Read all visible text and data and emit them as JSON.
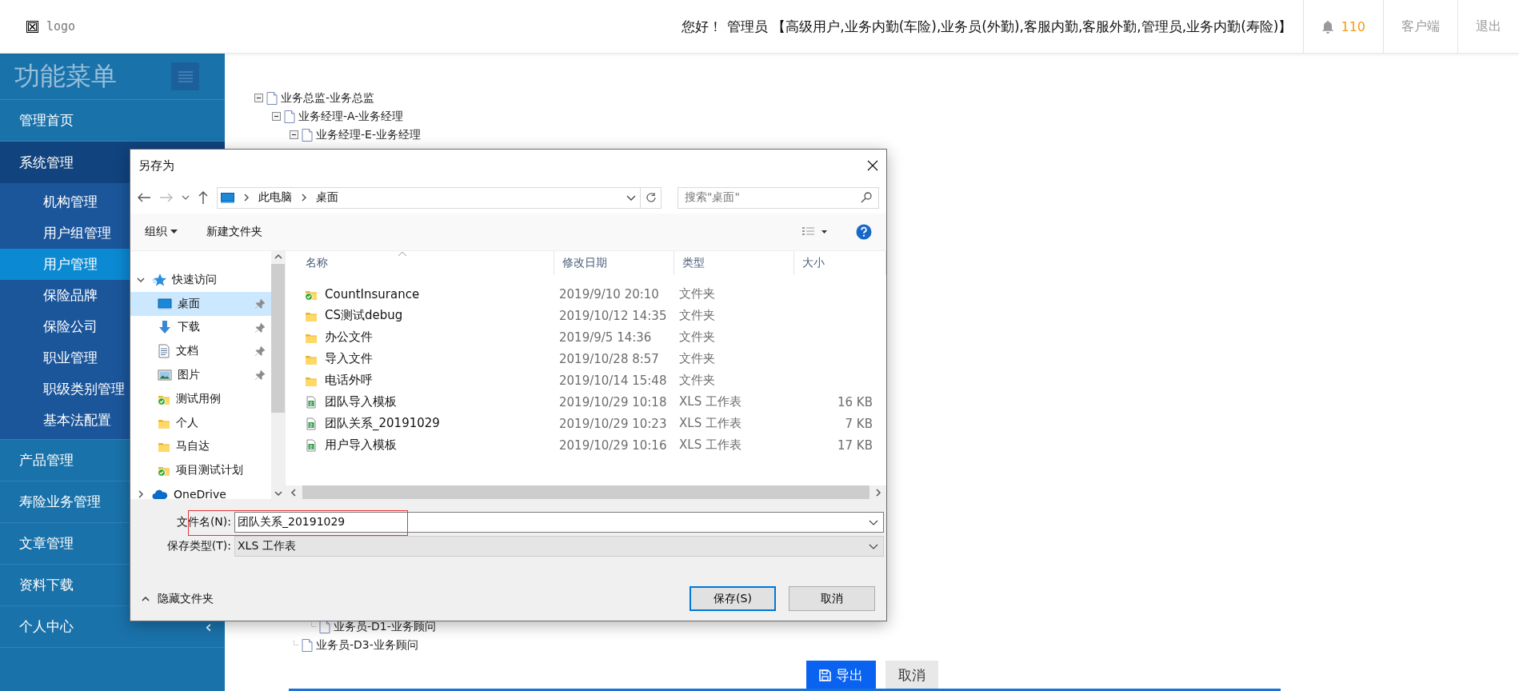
{
  "header": {
    "logo": "logo",
    "greeting": "您好！ 管理员 【高级用户,业务内勤(车险),业务员(外勤),客服内勤,客服外勤,管理员,业务内勤(寿险)】",
    "notification_count": "110",
    "links": [
      "客户端",
      "退出"
    ]
  },
  "sidebar": {
    "title": "功能菜单",
    "items": [
      {
        "label": "管理首页",
        "expanded": false
      },
      {
        "label": "系统管理",
        "expanded": true,
        "children": [
          {
            "label": "机构管理",
            "selected": false
          },
          {
            "label": "用户组管理",
            "selected": false
          },
          {
            "label": "用户管理",
            "selected": true
          },
          {
            "label": "保险品牌",
            "selected": false
          },
          {
            "label": "保险公司",
            "selected": false
          },
          {
            "label": "职业管理",
            "selected": false
          },
          {
            "label": "职级类别管理",
            "selected": false
          },
          {
            "label": "基本法配置",
            "selected": false
          }
        ]
      },
      {
        "label": "产品管理",
        "expanded": false
      },
      {
        "label": "寿险业务管理",
        "expanded": false
      },
      {
        "label": "文章管理",
        "expanded": false
      },
      {
        "label": "资料下载",
        "expanded": false
      },
      {
        "label": "个人中心",
        "expanded": false,
        "chevron": "‹"
      }
    ]
  },
  "tree": [
    {
      "label": "业务总监-业务总监",
      "expanded": true,
      "children": [
        {
          "label": "业务经理-A-业务经理",
          "expanded": true,
          "children": [
            {
              "label": "业务经理-E-业务经理",
              "expanded": true,
              "children": [
                {
                  "label": "业务员-D1-业务顾问"
                }
              ]
            },
            {
              "label": "业务员-D3-业务顾问"
            }
          ]
        }
      ]
    }
  ],
  "actions": [
    {
      "label": "导出",
      "kind": "primary"
    },
    {
      "label": "取消",
      "kind": "secondary"
    }
  ],
  "save_dialog": {
    "title": "另存为",
    "path": [
      "此电脑",
      "桌面"
    ],
    "search": {
      "placeholder": "搜索\"桌面\""
    },
    "toolbar": [
      "组织",
      "新建文件夹"
    ],
    "nav_items": [
      {
        "label": "快速访问",
        "kind": "group",
        "expanded": true,
        "pinned": false,
        "selected": false
      },
      {
        "label": "桌面",
        "kind": "desktop",
        "pinned": true,
        "selected": true
      },
      {
        "label": "下载",
        "kind": "download",
        "pinned": true,
        "selected": false
      },
      {
        "label": "文档",
        "kind": "document",
        "pinned": true,
        "selected": false
      },
      {
        "label": "图片",
        "kind": "image",
        "pinned": true,
        "selected": false
      },
      {
        "label": "测试用例",
        "kind": "synced",
        "pinned": false,
        "selected": false
      },
      {
        "label": "个人",
        "kind": "folder",
        "pinned": false,
        "selected": false
      },
      {
        "label": "马自达",
        "kind": "folder",
        "pinned": false,
        "selected": false
      },
      {
        "label": "项目测试计划",
        "kind": "synced",
        "pinned": false,
        "selected": false
      },
      {
        "label": "OneDrive",
        "kind": "cloud",
        "expanded": false,
        "pinned": false,
        "selected": false
      }
    ],
    "columns": [
      "名称",
      "修改日期",
      "类型",
      "大小"
    ],
    "files": [
      {
        "name": "CountInsurance",
        "date": "2019/9/10 20:10",
        "type": "文件夹",
        "kind": "synced"
      },
      {
        "name": "CS测试debug",
        "date": "2019/10/12 14:35",
        "type": "文件夹",
        "kind": "folder"
      },
      {
        "name": "办公文件",
        "date": "2019/9/5 14:36",
        "type": "文件夹",
        "kind": "folder"
      },
      {
        "name": "导入文件",
        "date": "2019/10/28 8:57",
        "type": "文件夹",
        "kind": "folder"
      },
      {
        "name": "电话外呼",
        "date": "2019/10/14 15:48",
        "type": "文件夹",
        "kind": "folder"
      },
      {
        "name": "团队导入模板",
        "date": "2019/10/29 10:18",
        "type": "XLS 工作表",
        "size": "16 KB",
        "kind": "sheet"
      },
      {
        "name": "团队关系_20191029",
        "date": "2019/10/29 10:23",
        "type": "XLS 工作表",
        "size": "7 KB",
        "kind": "sheet"
      },
      {
        "name": "用户导入模板",
        "date": "2019/10/29 10:16",
        "type": "XLS 工作表",
        "size": "17 KB",
        "kind": "sheet"
      }
    ],
    "filename": {
      "label": "文件名(N):",
      "value": "团队关系_20191029",
      "highlighted": true
    },
    "file_type": {
      "label": "保存类型(T):",
      "value": "XLS 工作表"
    },
    "hide_folders": "隐藏文件夹",
    "buttons": [
      {
        "label": "保存(S)",
        "kind": "default"
      },
      {
        "label": "取消",
        "kind": "normal"
      }
    ]
  }
}
